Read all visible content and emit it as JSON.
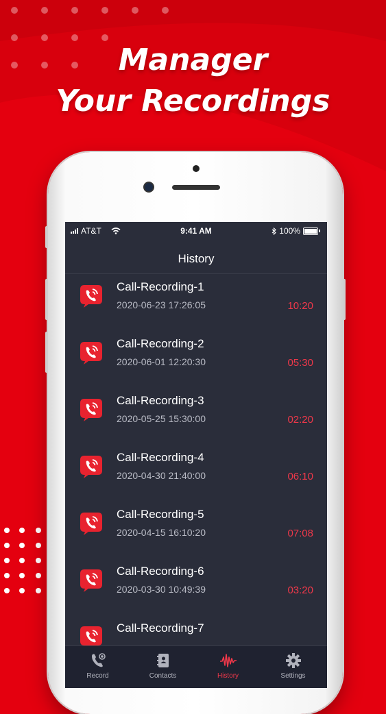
{
  "headline": {
    "line1": "Manager",
    "line2": "Your Recordings"
  },
  "colors": {
    "brand_red": "#e4000f",
    "screen_bg": "#2a2d3a",
    "accent_red": "#f0384a",
    "tab_active": "#f0384a"
  },
  "status_bar": {
    "carrier": "AT&T",
    "time": "9:41 AM",
    "battery": "100%",
    "icons": [
      "signal-icon",
      "wifi-icon",
      "bluetooth-icon",
      "battery-icon"
    ]
  },
  "screen": {
    "title": "History"
  },
  "recordings": [
    {
      "title": "Call-Recording-1",
      "date": "2020-06-23 17:26:05",
      "duration": "10:20",
      "icon": "call-recording-icon"
    },
    {
      "title": "Call-Recording-2",
      "date": "2020-06-01 12:20:30",
      "duration": "05:30",
      "icon": "call-recording-icon"
    },
    {
      "title": "Call-Recording-3",
      "date": "2020-05-25 15:30:00",
      "duration": "02:20",
      "icon": "call-recording-icon"
    },
    {
      "title": "Call-Recording-4",
      "date": "2020-04-30 21:40:00",
      "duration": "06:10",
      "icon": "call-recording-icon"
    },
    {
      "title": "Call-Recording-5",
      "date": "2020-04-15 16:10:20",
      "duration": "07:08",
      "icon": "call-recording-icon"
    },
    {
      "title": "Call-Recording-6",
      "date": "2020-03-30 10:49:39",
      "duration": "03:20",
      "icon": "call-recording-icon"
    },
    {
      "title": "Call-Recording-7",
      "date": "",
      "duration": "",
      "icon": "call-recording-icon"
    }
  ],
  "tabbar": {
    "tabs": [
      {
        "label": "Record",
        "icon": "phone-record-icon",
        "active": false
      },
      {
        "label": "Contacts",
        "icon": "contacts-book-icon",
        "active": false
      },
      {
        "label": "History",
        "icon": "waveform-icon",
        "active": true
      },
      {
        "label": "Settings",
        "icon": "gear-icon",
        "active": false
      }
    ]
  }
}
